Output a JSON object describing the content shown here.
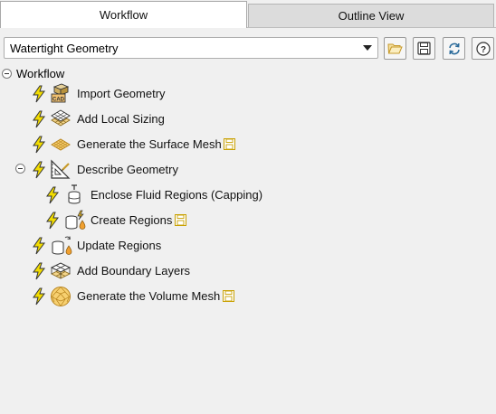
{
  "tabs": [
    {
      "label": "Workflow",
      "active": true
    },
    {
      "label": "Outline View",
      "active": false
    }
  ],
  "toolbar": {
    "workflow_select": "Watertight Geometry",
    "buttons": [
      {
        "name": "load-workflow-button",
        "icon": "folder-icon"
      },
      {
        "name": "save-workflow-button",
        "icon": "save-icon"
      },
      {
        "name": "refresh-workflow-button",
        "icon": "refresh-icon"
      },
      {
        "name": "help-button",
        "icon": "help-icon"
      }
    ]
  },
  "tree": {
    "root": "Workflow",
    "tasks": [
      {
        "label": "Import Geometry",
        "icon": "cad-import-icon",
        "saved": false
      },
      {
        "label": "Add Local Sizing",
        "icon": "local-sizing-icon",
        "saved": false
      },
      {
        "label": "Generate the Surface Mesh",
        "icon": "surface-mesh-icon",
        "saved": true
      },
      {
        "label": "Describe Geometry",
        "icon": "describe-geometry-icon",
        "saved": false,
        "expanded": true
      },
      {
        "label": "Enclose Fluid Regions (Capping)",
        "icon": "capping-icon",
        "saved": false
      },
      {
        "label": "Create Regions",
        "icon": "create-regions-icon",
        "saved": true
      },
      {
        "label": "Update Regions",
        "icon": "update-regions-icon",
        "saved": false
      },
      {
        "label": "Add Boundary Layers",
        "icon": "boundary-layers-icon",
        "saved": false
      },
      {
        "label": "Generate the Volume Mesh",
        "icon": "volume-mesh-icon",
        "saved": true
      }
    ]
  },
  "colors": {
    "bolt": "#f2dc00",
    "save_icon": "#c8a000",
    "mesh": "#d69a2a"
  }
}
